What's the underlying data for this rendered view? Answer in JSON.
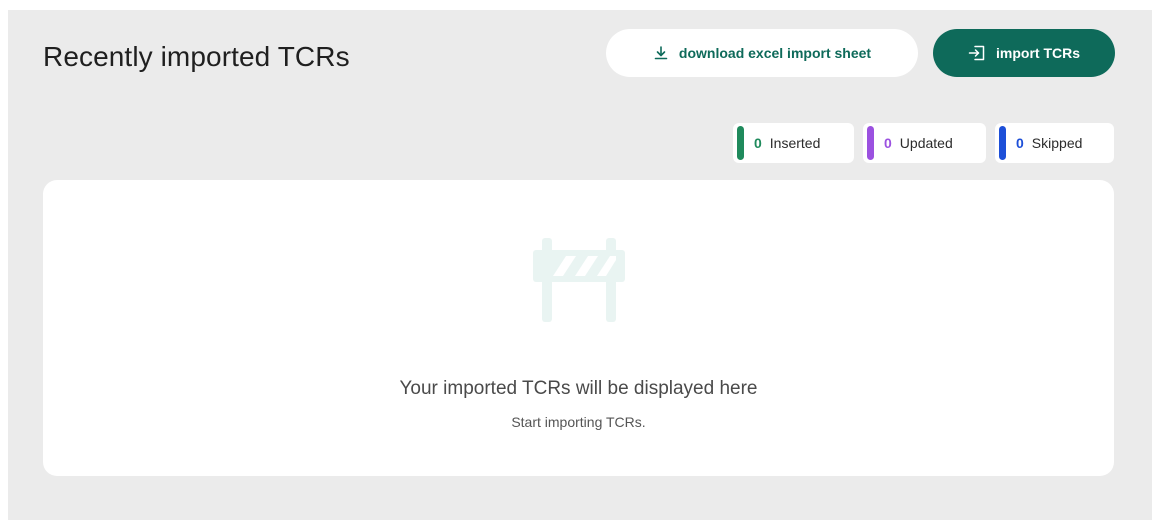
{
  "header": {
    "title": "Recently imported TCRs",
    "download_label": "download excel import sheet",
    "import_label": "import TCRs"
  },
  "counters": [
    {
      "name": "inserted",
      "count": "0",
      "label": "Inserted",
      "color": "#1f8a5c"
    },
    {
      "name": "updated",
      "count": "0",
      "label": "Updated",
      "color": "#9b51e0"
    },
    {
      "name": "skipped",
      "count": "0",
      "label": "Skipped",
      "color": "#1d4fd8"
    }
  ],
  "empty_state": {
    "icon": "barrier-icon",
    "title": "Your imported TCRs will be displayed here",
    "subtitle": "Start importing TCRs."
  },
  "colors": {
    "accent": "#0e6a5a",
    "background": "#ebebeb",
    "panel": "#ffffff"
  }
}
